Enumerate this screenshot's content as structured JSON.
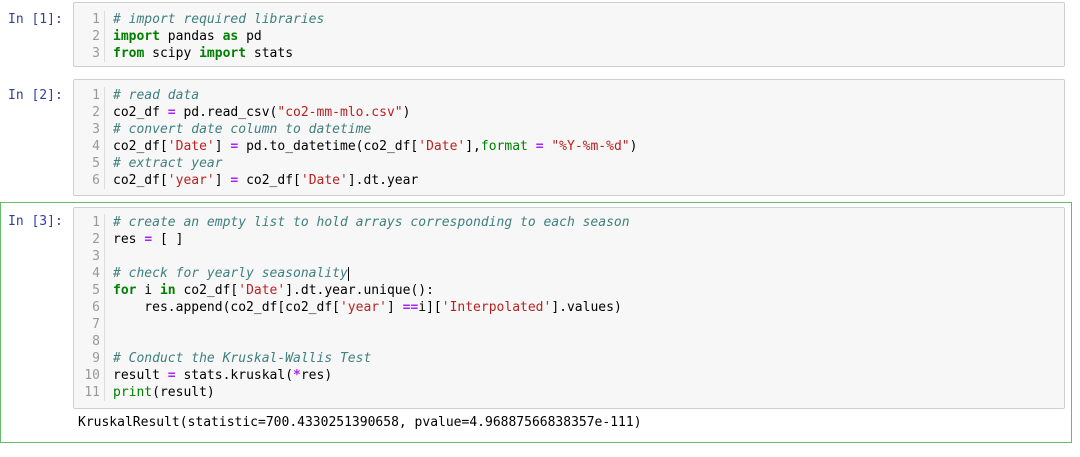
{
  "cells": [
    {
      "prompt": "In [1]:",
      "lines": [
        {
          "n": "1",
          "tokens": [
            {
              "t": "# import required libraries",
              "c": "cm"
            }
          ]
        },
        {
          "n": "2",
          "tokens": [
            {
              "t": "import",
              "c": "kw"
            },
            {
              "t": " pandas ",
              "c": ""
            },
            {
              "t": "as",
              "c": "kw"
            },
            {
              "t": " pd",
              "c": ""
            }
          ]
        },
        {
          "n": "3",
          "tokens": [
            {
              "t": "from",
              "c": "kw"
            },
            {
              "t": " scipy ",
              "c": ""
            },
            {
              "t": "import",
              "c": "kw"
            },
            {
              "t": " stats",
              "c": ""
            }
          ]
        }
      ]
    },
    {
      "prompt": "In [2]:",
      "lines": [
        {
          "n": "1",
          "tokens": [
            {
              "t": "# read data",
              "c": "cm"
            }
          ]
        },
        {
          "n": "2",
          "tokens": [
            {
              "t": "co2_df ",
              "c": ""
            },
            {
              "t": "=",
              "c": "op"
            },
            {
              "t": " pd.read_csv(",
              "c": ""
            },
            {
              "t": "\"co2-mm-mlo.csv\"",
              "c": "st"
            },
            {
              "t": ")",
              "c": ""
            }
          ]
        },
        {
          "n": "3",
          "tokens": [
            {
              "t": "# convert date column to datetime",
              "c": "cm"
            }
          ]
        },
        {
          "n": "4",
          "tokens": [
            {
              "t": "co2_df[",
              "c": ""
            },
            {
              "t": "'Date'",
              "c": "st"
            },
            {
              "t": "] ",
              "c": ""
            },
            {
              "t": "=",
              "c": "op"
            },
            {
              "t": " pd.to_datetime(co2_df[",
              "c": ""
            },
            {
              "t": "'Date'",
              "c": "st"
            },
            {
              "t": "],",
              "c": ""
            },
            {
              "t": "format",
              "c": "bi"
            },
            {
              "t": " ",
              "c": ""
            },
            {
              "t": "=",
              "c": "op"
            },
            {
              "t": " ",
              "c": ""
            },
            {
              "t": "\"%Y-%m-%d\"",
              "c": "st"
            },
            {
              "t": ")",
              "c": ""
            }
          ]
        },
        {
          "n": "5",
          "tokens": [
            {
              "t": "# extract year",
              "c": "cm"
            }
          ]
        },
        {
          "n": "6",
          "tokens": [
            {
              "t": "co2_df[",
              "c": ""
            },
            {
              "t": "'year'",
              "c": "st"
            },
            {
              "t": "] ",
              "c": ""
            },
            {
              "t": "=",
              "c": "op"
            },
            {
              "t": " co2_df[",
              "c": ""
            },
            {
              "t": "'Date'",
              "c": "st"
            },
            {
              "t": "].dt.year",
              "c": ""
            }
          ]
        }
      ]
    },
    {
      "prompt": "In [3]:",
      "lines": [
        {
          "n": "1",
          "tokens": [
            {
              "t": "# create an empty list to hold arrays corresponding to each season",
              "c": "cm"
            }
          ]
        },
        {
          "n": "2",
          "tokens": [
            {
              "t": "res ",
              "c": ""
            },
            {
              "t": "=",
              "c": "op"
            },
            {
              "t": " [ ]",
              "c": ""
            }
          ]
        },
        {
          "n": "3",
          "tokens": []
        },
        {
          "n": "4",
          "tokens": [
            {
              "t": "# check for yearly seasonality",
              "c": "cm"
            }
          ],
          "cursor": true
        },
        {
          "n": "5",
          "tokens": [
            {
              "t": "for",
              "c": "kw"
            },
            {
              "t": " i ",
              "c": ""
            },
            {
              "t": "in",
              "c": "kw"
            },
            {
              "t": " co2_df[",
              "c": ""
            },
            {
              "t": "'Date'",
              "c": "st"
            },
            {
              "t": "].dt.year.unique():",
              "c": ""
            }
          ]
        },
        {
          "n": "6",
          "tokens": [
            {
              "t": "    res.append(co2_df[co2_df[",
              "c": ""
            },
            {
              "t": "'year'",
              "c": "st"
            },
            {
              "t": "] ",
              "c": ""
            },
            {
              "t": "==",
              "c": "op"
            },
            {
              "t": "i][",
              "c": ""
            },
            {
              "t": "'Interpolated'",
              "c": "st"
            },
            {
              "t": "].values)",
              "c": ""
            }
          ]
        },
        {
          "n": "7",
          "tokens": []
        },
        {
          "n": "8",
          "tokens": []
        },
        {
          "n": "9",
          "tokens": [
            {
              "t": "# Conduct the Kruskal-Wallis Test",
              "c": "cm"
            }
          ]
        },
        {
          "n": "10",
          "tokens": [
            {
              "t": "result ",
              "c": ""
            },
            {
              "t": "=",
              "c": "op"
            },
            {
              "t": " stats.kruskal(",
              "c": ""
            },
            {
              "t": "*",
              "c": "op"
            },
            {
              "t": "res)",
              "c": ""
            }
          ]
        },
        {
          "n": "11",
          "tokens": [
            {
              "t": "print",
              "c": "bi"
            },
            {
              "t": "(result)",
              "c": ""
            }
          ]
        }
      ],
      "output": "KruskalResult(statistic=700.4330251390658, pvalue=4.96887566838357e-111)"
    }
  ],
  "colors": {
    "prompt": "#303f9f",
    "comment": "#408080",
    "keyword": "#008000",
    "string": "#ba2121",
    "operator": "#aa22ff",
    "selected_border": "#66bb6a"
  }
}
